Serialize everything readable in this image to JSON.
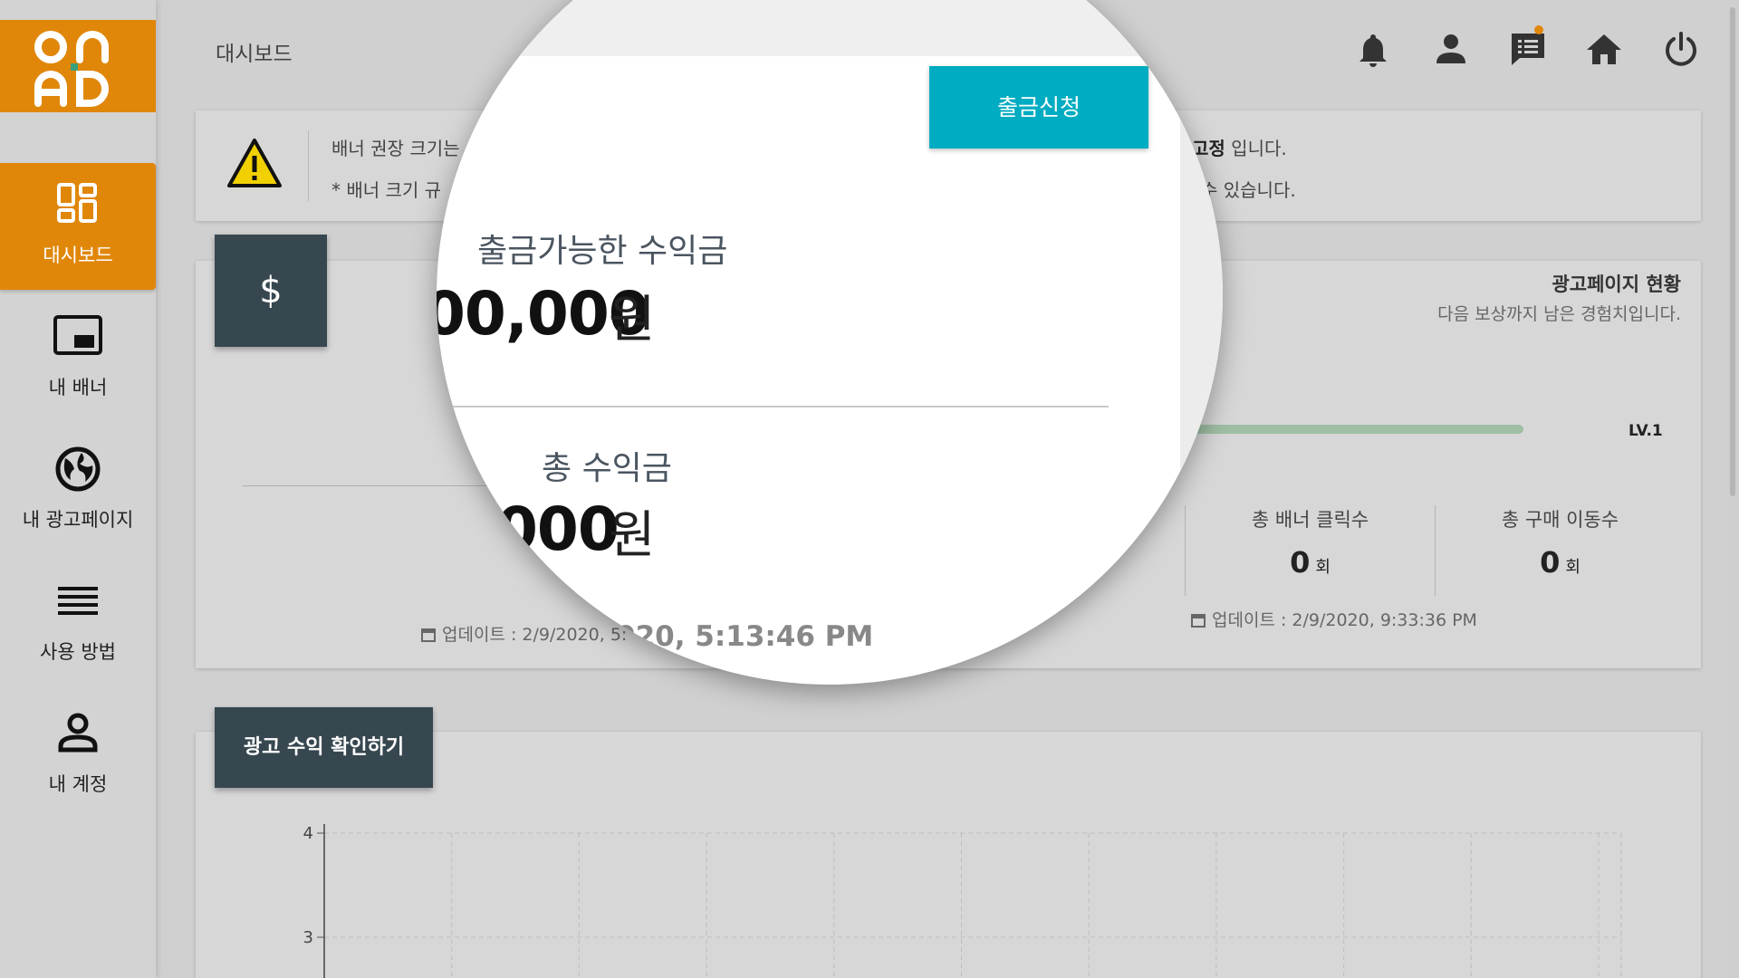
{
  "logo": {
    "text": "ON AD"
  },
  "sidebar": {
    "items": [
      {
        "label": "대시보드",
        "icon": "dashboard-icon",
        "active": true
      },
      {
        "label": "내 배너",
        "icon": "banner-icon"
      },
      {
        "label": "내 광고페이지",
        "icon": "globe-icon"
      },
      {
        "label": "사용 방법",
        "icon": "menu-lines-icon"
      },
      {
        "label": "내 계정",
        "icon": "person-icon"
      }
    ]
  },
  "header": {
    "title": "대시보드",
    "icons": [
      "bell-icon",
      "account-icon",
      "chat-icon",
      "home-icon",
      "power-icon"
    ]
  },
  "notice": {
    "line1_left": "배너 권장 크기는",
    "line1_right_bold": "고정",
    "line1_right": " 입니다.",
    "line2_left": "* 배너 크기 규",
    "line2_right": "수 있습니다."
  },
  "income": {
    "withdraw_button": "출금신청",
    "available_label": "출금가능한 수익금",
    "available_value": "00,000",
    "unit": "원",
    "total_label": "총 수익금",
    "total_value": "000",
    "update_bg": "업데이트 : 2/9/2020, 5:",
    "update_zoom": "020, 5:13:46 PM",
    "partial_zero": "0"
  },
  "ad_page": {
    "title": "광고페이지 현황",
    "subtitle": "다음 보상까지 남은 경험치입니다.",
    "level": "LV.1",
    "level_progress": 1.0,
    "banner_clicks_label": "총 배너 클릭수",
    "banner_clicks_value": "0",
    "purchase_moves_label": "총 구매 이동수",
    "purchase_moves_value": "0",
    "count_unit": "회",
    "update": "업데이트 : 2/9/2020, 9:33:36 PM"
  },
  "chart_section": {
    "button_label": "광고 수익 확인하기"
  },
  "chart_data": {
    "type": "line",
    "y_ticks": [
      "4",
      "3"
    ],
    "series": []
  },
  "colors": {
    "brand_orange": "#e0870a",
    "dark_slate": "#374750",
    "accent_teal": "#00acc1",
    "progress_green": "#9fbfa4"
  }
}
